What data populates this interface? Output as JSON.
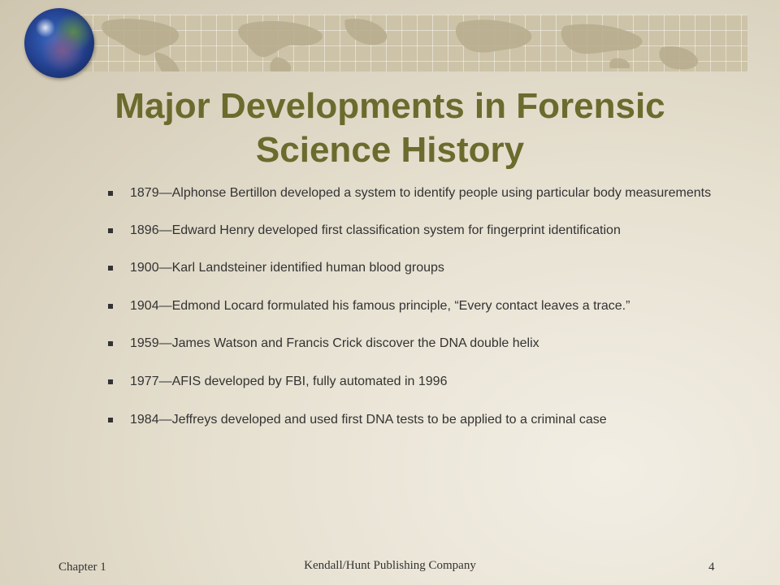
{
  "slide": {
    "title_lines": [
      "Major Developments in Forensic",
      "Science History"
    ],
    "bullets": [
      "1879—Alphonse Bertillon developed a system to identify people using particular body measurements",
      "1896—Edward Henry developed first classification system for fingerprint identification",
      "1900—Karl Landsteiner identified human blood groups",
      "1904—Edmond Locard formulated his famous principle, “Every contact leaves a trace.”",
      "1959—James Watson and Francis Crick discover the DNA double helix",
      "1977—AFIS developed by FBI, fully automated in 1996",
      "1984—Jeffreys developed and used first DNA tests to be applied to a criminal case"
    ],
    "colors": {
      "title": "#6b6b2e",
      "body_text": "#333333",
      "banner": "#cdc3a8"
    },
    "icons": {
      "logo": "globe-icon",
      "bullet": "square-bullet"
    }
  },
  "footer": {
    "chapter": "Chapter 1",
    "publisher": "Kendall/Hunt Publishing Company",
    "page": "4"
  }
}
